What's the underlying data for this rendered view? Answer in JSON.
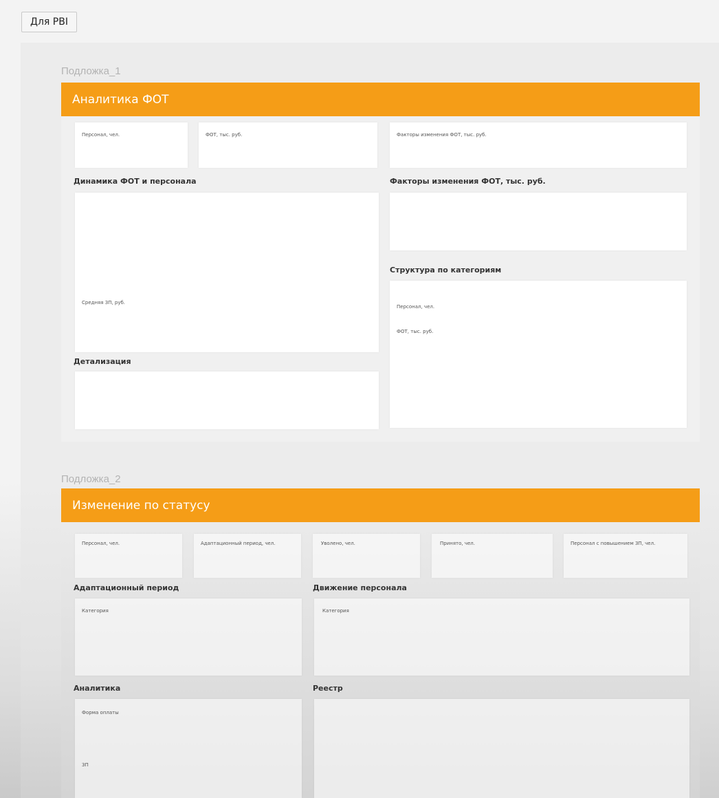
{
  "toolbar": {
    "button_label": "Для PBI"
  },
  "layer1": {
    "label": "Подложка_1",
    "title": "Аналитика ФОТ",
    "kpi": [
      "Персонал, чел.",
      "ФОТ, тыс. руб.",
      "Факторы изменения ФОТ, тыс. руб."
    ],
    "sections": {
      "dynamics": "Динамика ФОТ и персонала",
      "avg_salary": "Средняя ЗП, руб.",
      "detail": "Детализация",
      "factors": "Факторы изменения ФОТ, тыс. руб.",
      "structure": "Структура по категориям",
      "structure_personnel": "Персонал, чел.",
      "structure_fot": "ФОТ, тыс. руб."
    }
  },
  "layer2": {
    "label": "Подложка_2",
    "title": "Изменение по статусу",
    "kpi": [
      "Персонал, чел.",
      "Адаптационный период, чел.",
      "Уволено, чел.",
      "Принято, чел.",
      "Персонал с повышением ЗП, чел."
    ],
    "sections": {
      "adaptation": "Адаптационный период",
      "adaptation_category": "Категория",
      "movement": "Движение персонала",
      "movement_category": "Категория",
      "analytics": "Аналитика",
      "payment_form": "Форма оплаты",
      "salary": "ЗП",
      "registry": "Реестр"
    }
  }
}
